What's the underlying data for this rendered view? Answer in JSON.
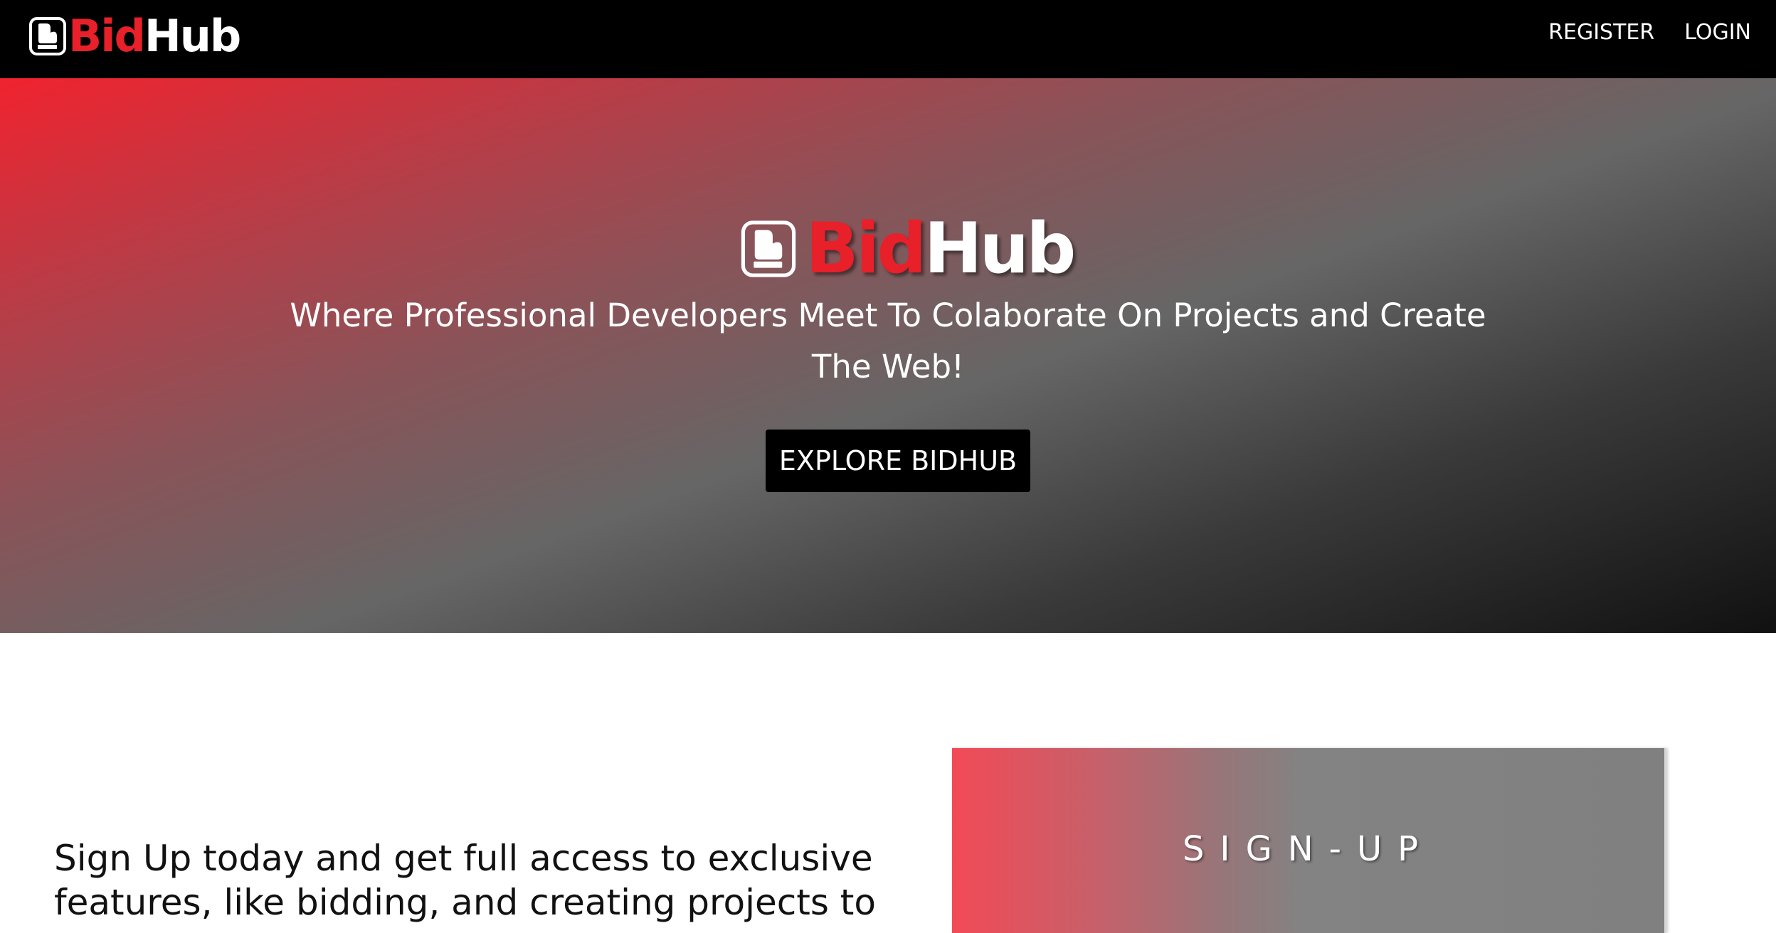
{
  "brand": {
    "bid": "Bid",
    "hub": "Hub",
    "logo_icon": "oven-mitt-icon",
    "colors": {
      "bid": "#e8202a",
      "hub": "#ffffff"
    }
  },
  "nav": {
    "links": [
      {
        "label": "REGISTER"
      },
      {
        "label": "LOGIN"
      }
    ]
  },
  "hero": {
    "tagline": "Where Professional Developers Meet To Colaborate On Projects and Create The Web!",
    "button_label": "EXPLORE BIDHUB"
  },
  "signup": {
    "text": "Sign Up today and get full access to exclusive features, like bidding, and creating projects to",
    "card_title": "SIGN-UP"
  }
}
